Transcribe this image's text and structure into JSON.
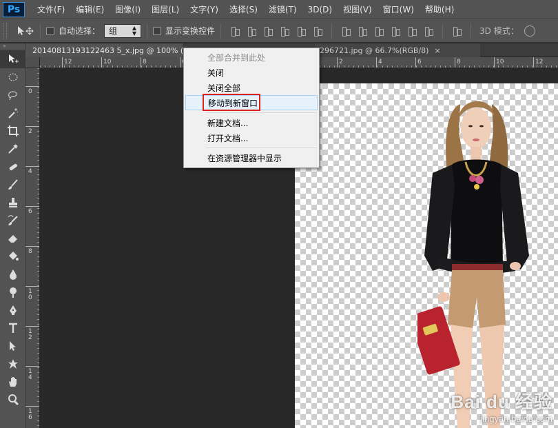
{
  "app": {
    "logo": "Ps"
  },
  "menu": [
    "文件(F)",
    "编辑(E)",
    "图像(I)",
    "图层(L)",
    "文字(Y)",
    "选择(S)",
    "滤镜(T)",
    "3D(D)",
    "视图(V)",
    "窗口(W)",
    "帮助(H)"
  ],
  "options_bar": {
    "auto_select_label": "自动选择：",
    "auto_select_checked": false,
    "group_select_value": "组",
    "show_transform_label": "显示变换控件",
    "show_transform_checked": false,
    "mode3d_label": "3D 模式："
  },
  "tabs": [
    {
      "title": "20140813193122463 5_x.jpg @ 100% (图层"
    },
    {
      "title": "6296721.jpg @ 66.7%(RGB/8)",
      "close": "×"
    }
  ],
  "ruler_top_labels": [
    "12",
    "10",
    "8",
    "6",
    "4",
    "2",
    "0",
    "2",
    "4",
    "6",
    "8",
    "10",
    "12"
  ],
  "ruler_left_labels": [
    "0",
    "2",
    "4",
    "6",
    "8",
    "10",
    "12",
    "14",
    "16"
  ],
  "tools": [
    "move-tool",
    "marquee-tool",
    "lasso-tool",
    "magic-wand-tool",
    "crop-tool",
    "eyedropper-tool",
    "healing-brush-tool",
    "brush-tool",
    "stamp-tool",
    "history-brush-tool",
    "eraser-tool",
    "gradient-tool",
    "blur-tool",
    "dodge-tool",
    "pen-tool",
    "type-tool",
    "path-selection-tool",
    "shape-tool",
    "hand-tool",
    "zoom-tool"
  ],
  "context_menu": {
    "items": [
      {
        "label": "全部合并到此处",
        "disabled": true
      },
      {
        "label": "关闭",
        "disabled": false
      },
      {
        "label": "关闭全部",
        "disabled": false
      },
      {
        "label": "移动到新窗口",
        "disabled": false,
        "hover": true
      },
      {
        "label": "新建文档...",
        "disabled": false
      },
      {
        "label": "打开文档...",
        "disabled": false
      },
      {
        "label": "在资源管理器中显示",
        "disabled": false
      }
    ]
  },
  "watermark": {
    "brand": "Bai du 经验",
    "url": "jingyan.baidu.com"
  },
  "colors": {
    "highlight": "#e0201b",
    "ui_panel": "#535353",
    "pasteboard": "#282828"
  }
}
